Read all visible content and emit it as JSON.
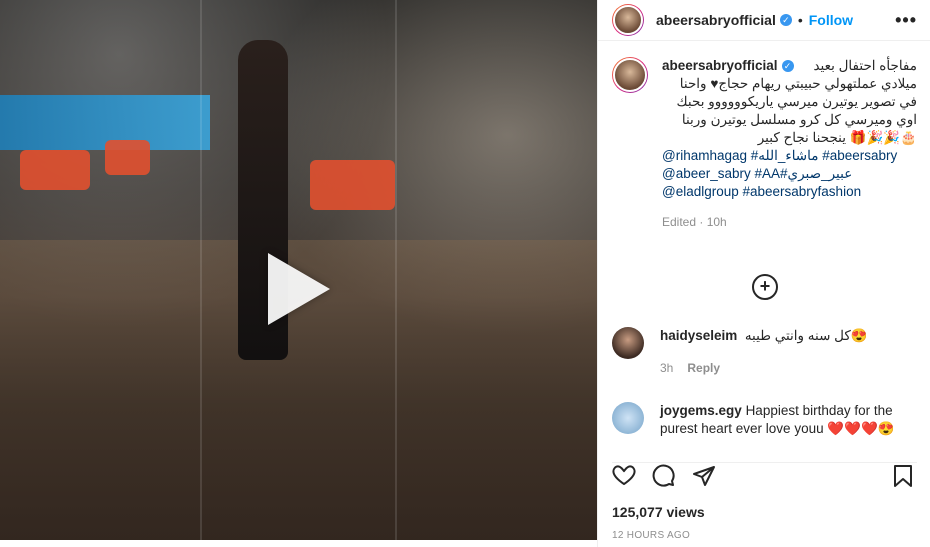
{
  "header": {
    "username": "abeersabryofficial",
    "separator": "•",
    "follow_label": "Follow",
    "more_label": "•••"
  },
  "caption": {
    "username": "abeersabryofficial",
    "line1": "مفاجأه احتفال بعيد",
    "line2": "ميلادي عملتهولي حبيبتي ريهام حجاج♥ واحنا",
    "line3": "في تصوير يوتيرن ميرسي ياريكوووووو بحبك",
    "line4": "اوي وميرسي كل كرو مسلسل يوتيرن وربنا",
    "line5": "🎂🎉🎉🎁 ينجحنا نجاح كبير",
    "tags1": "@rihamhagag #ماشاء_الله #abeersabry",
    "tags2": "@abeer_sabry #AA#عبير_صبري",
    "tags3": "@eladlgroup #abeersabryfashion",
    "edited": "Edited · 10h"
  },
  "comments": [
    {
      "username": "haidyseleim",
      "text": "كل سنه وانتي طيبه😍",
      "time": "3h",
      "reply": "Reply"
    },
    {
      "username": "joygems.egy",
      "text": "Happiest birthday for the purest heart ever love youu ❤️❤️❤️😍"
    }
  ],
  "stats": {
    "views": "125,077 views",
    "ago": "12 HOURS AGO"
  },
  "icons": [
    "verified-badge-icon",
    "more-options-icon",
    "add-comment-icon",
    "play-icon",
    "heart-icon",
    "comment-icon",
    "share-icon",
    "save-icon"
  ],
  "colors": {
    "follow": "#0095f6",
    "verified": "#3897f0",
    "secondary_text": "#8e8e8e"
  }
}
